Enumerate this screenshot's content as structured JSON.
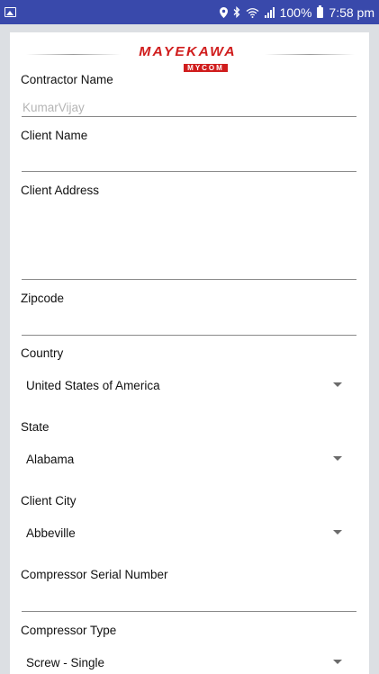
{
  "status": {
    "battery": "100%",
    "time": "7:58 pm"
  },
  "logo": {
    "brand": "MAYEKAWA",
    "sub": "MYCOM"
  },
  "form": {
    "contractor_label": "Contractor Name",
    "contractor_value": "KumarVijay",
    "client_name_label": "Client Name",
    "client_address_label": "Client Address",
    "zipcode_label": "Zipcode",
    "country_label": "Country",
    "country_value": "United States of America",
    "state_label": "State",
    "state_value": "Alabama",
    "city_label": "Client City",
    "city_value": "Abbeville",
    "serial_label": "Compressor Serial Number",
    "type_label": "Compressor Type",
    "type_value": "Screw - Single"
  }
}
